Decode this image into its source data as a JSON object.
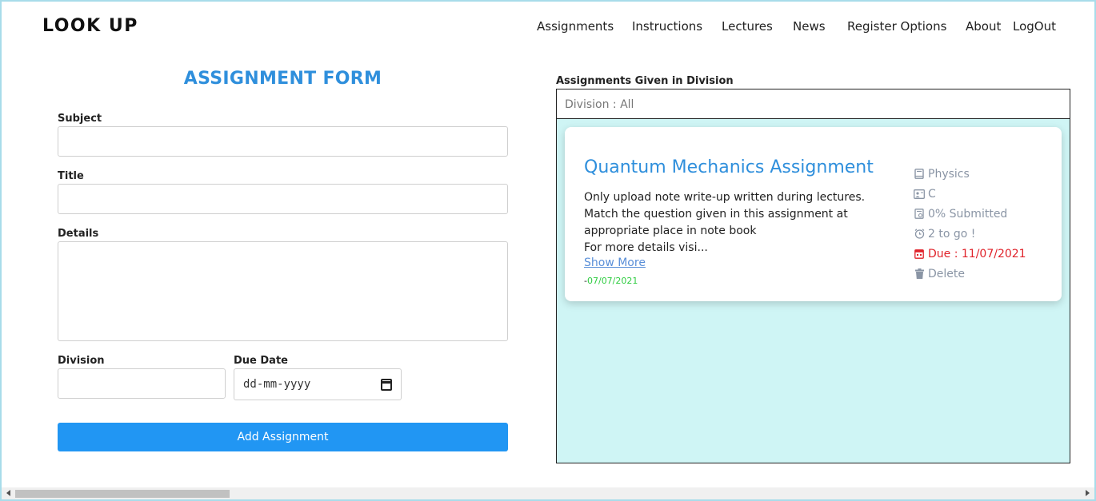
{
  "brand": "LOOK UP",
  "nav": {
    "items": [
      "Assignments",
      "Instructions",
      "Lectures",
      "News",
      "Register Options",
      "About",
      "LogOut"
    ]
  },
  "form": {
    "title": "ASSIGNMENT FORM",
    "subject_label": "Subject",
    "subject_value": "",
    "title_label": "Title",
    "title_value": "",
    "details_label": "Details",
    "details_value": "",
    "division_label": "Division",
    "division_value": "",
    "due_date_label": "Due Date",
    "due_date_placeholder": "dd-mm-yyyy",
    "submit_label": "Add Assignment"
  },
  "panel": {
    "title": "Assignments Given in Division",
    "division_filter": "Division : All"
  },
  "assignments": [
    {
      "title": "Quantum Mechanics Assignment",
      "description_lines": [
        "Only upload note write-up written during lectures.",
        "Match the question given in this assignment at",
        "appropriate place in note book",
        "For more details visi..."
      ],
      "show_more": "Show More",
      "posted_prefix": "-",
      "posted_date": "07/07/2021",
      "subject": "Physics",
      "division": "C",
      "submitted": "0% Submitted",
      "time_left": "2 to go !",
      "due": "Due : 11/07/2021",
      "delete_label": "Delete"
    }
  ],
  "colors": {
    "accent": "#2f8fdc",
    "button": "#2196f3",
    "panel_bg": "#cff5f5",
    "due": "#e0222a",
    "posted_date": "#2ecc40",
    "meta": "#8a95a5"
  }
}
